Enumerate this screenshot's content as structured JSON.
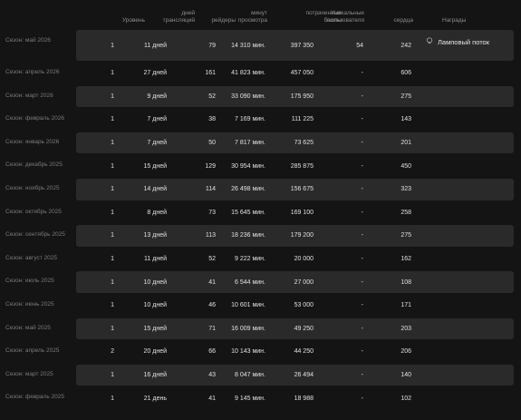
{
  "columns": {
    "level": "Уровень",
    "days": "дней\nтрансляций",
    "raiders": "рейдеры",
    "minutes": "минут\nпросмотра",
    "points": "потраченные\nбаллы",
    "unique": "Уникальные\nпользователя",
    "hearts": "сердца",
    "rewards": "Награды"
  },
  "rows": [
    {
      "season": "Сезон: май 2026",
      "level": "1",
      "days": "11 дней",
      "raiders": "79",
      "minutes": "14 310 мин.",
      "points": "397 350",
      "unique": "54",
      "hearts": "242",
      "reward": "Ламповый поток",
      "highlight": true
    },
    {
      "season": "Сезон: апрель 2026",
      "level": "1",
      "days": "27 дней",
      "raiders": "161",
      "minutes": "41 823 мин.",
      "points": "457 050",
      "unique": "-",
      "hearts": "606",
      "highlight": false
    },
    {
      "season": "Сезон: март 2026",
      "level": "1",
      "days": "9 дней",
      "raiders": "52",
      "minutes": "33 090 мин.",
      "points": "175 950",
      "unique": "-",
      "hearts": "275",
      "highlight": true
    },
    {
      "season": "Сезон: февраль 2026",
      "level": "1",
      "days": "7 дней",
      "raiders": "38",
      "minutes": "7 169 мин.",
      "points": "111 225",
      "unique": "-",
      "hearts": "143",
      "highlight": false
    },
    {
      "season": "Сезон: январь 2026",
      "level": "1",
      "days": "7 дней",
      "raiders": "50",
      "minutes": "7 817 мин.",
      "points": "73 625",
      "unique": "-",
      "hearts": "201",
      "highlight": true
    },
    {
      "season": "Сезон: декабрь 2025",
      "level": "1",
      "days": "15 дней",
      "raiders": "129",
      "minutes": "30 954 мин.",
      "points": "285 875",
      "unique": "-",
      "hearts": "450",
      "highlight": false
    },
    {
      "season": "Сезон: ноябрь 2025",
      "level": "1",
      "days": "14 дней",
      "raiders": "114",
      "minutes": "26 498 мин.",
      "points": "156 675",
      "unique": "-",
      "hearts": "323",
      "highlight": true
    },
    {
      "season": "Сезон: октябрь 2025",
      "level": "1",
      "days": "8 дней",
      "raiders": "73",
      "minutes": "15 645 мин.",
      "points": "169 100",
      "unique": "-",
      "hearts": "258",
      "highlight": false
    },
    {
      "season": "Сезон: сентябрь 2025",
      "level": "1",
      "days": "13 дней",
      "raiders": "113",
      "minutes": "18 236 мин.",
      "points": "179 200",
      "unique": "-",
      "hearts": "275",
      "highlight": true
    },
    {
      "season": "Сезон: август 2025",
      "level": "1",
      "days": "11 дней",
      "raiders": "52",
      "minutes": "9 222 мин.",
      "points": "20 000",
      "unique": "-",
      "hearts": "162",
      "highlight": false
    },
    {
      "season": "Сезон: июль 2025",
      "level": "1",
      "days": "10 дней",
      "raiders": "41",
      "minutes": "6 544 мин.",
      "points": "27 000",
      "unique": "-",
      "hearts": "108",
      "highlight": true
    },
    {
      "season": "Сезон: июнь 2025",
      "level": "1",
      "days": "10 дней",
      "raiders": "46",
      "minutes": "10 601 мин.",
      "points": "53 000",
      "unique": "-",
      "hearts": "171",
      "highlight": false
    },
    {
      "season": "Сезон: май 2025",
      "level": "1",
      "days": "15 дней",
      "raiders": "71",
      "minutes": "16 009 мин.",
      "points": "49 250",
      "unique": "-",
      "hearts": "203",
      "highlight": true
    },
    {
      "season": "Сезон: апрель 2025",
      "level": "2",
      "days": "20 дней",
      "raiders": "66",
      "minutes": "10 143 мин.",
      "points": "44 250",
      "unique": "-",
      "hearts": "206",
      "highlight": false
    },
    {
      "season": "Сезон: март 2025",
      "level": "1",
      "days": "16 дней",
      "raiders": "43",
      "minutes": "8 047 мин.",
      "points": "26 494",
      "unique": "-",
      "hearts": "140",
      "highlight": true
    },
    {
      "season": "Сезон: февраль 2025",
      "level": "1",
      "days": "21 день",
      "raiders": "41",
      "minutes": "9 145 мин.",
      "points": "18 988",
      "unique": "-",
      "hearts": "102",
      "highlight": false
    }
  ],
  "icons": {
    "reward_icon": "lamp-icon"
  },
  "colors": {
    "row_highlight": "#2a2a2a",
    "background": "#141414"
  }
}
